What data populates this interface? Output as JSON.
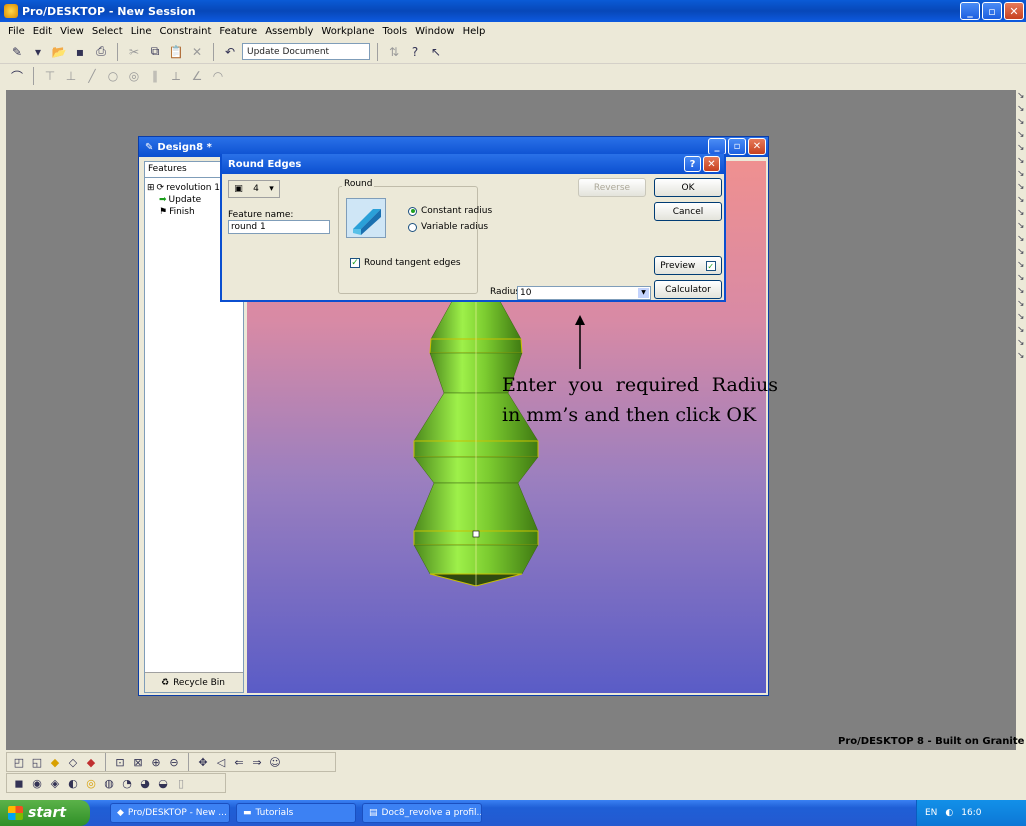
{
  "app": {
    "title": "Pro/DESKTOP - New Session"
  },
  "menu": [
    "File",
    "Edit",
    "View",
    "Select",
    "Line",
    "Constraint",
    "Feature",
    "Assembly",
    "Workplane",
    "Tools",
    "Window",
    "Help"
  ],
  "toolbar": {
    "update_document": "Update Document"
  },
  "design_window": {
    "title": "Design8 *"
  },
  "sidebar": {
    "dropdown": "Features",
    "tree": [
      {
        "label": "revolution 1"
      },
      {
        "label": "Update"
      },
      {
        "label": "Finish"
      }
    ],
    "recycle_bin": "Recycle Bin"
  },
  "dialog": {
    "title": "Round Edges",
    "edge_count": "4",
    "feature_name_label": "Feature name:",
    "feature_name_value": "round 1",
    "group_label": "Round",
    "radio_constant": "Constant radius",
    "radio_variable": "Variable radius",
    "check_tangent": "Round tangent edges",
    "buttons": {
      "reverse": "Reverse",
      "ok": "OK",
      "cancel": "Cancel",
      "preview": "Preview",
      "calculator": "Calculator"
    },
    "radius_label": "Radius [mm]:",
    "radius_value": "10"
  },
  "annotation": "Enter you required Radius in mm’s and then click OK",
  "branding": "Pro/DESKTOP 8 - Built on Granite",
  "taskbar": {
    "start": "start",
    "tasks": [
      "Pro/DESKTOP - New ...",
      "Tutorials",
      "Doc8_revolve a profil..."
    ],
    "tray_lang": "EN",
    "clock": "16:0"
  },
  "colors": {
    "titlebar": "#0b4fd0",
    "model": "#8ee03a",
    "viewport_top": "#ef9090",
    "viewport_bottom": "#5a5cc6"
  }
}
